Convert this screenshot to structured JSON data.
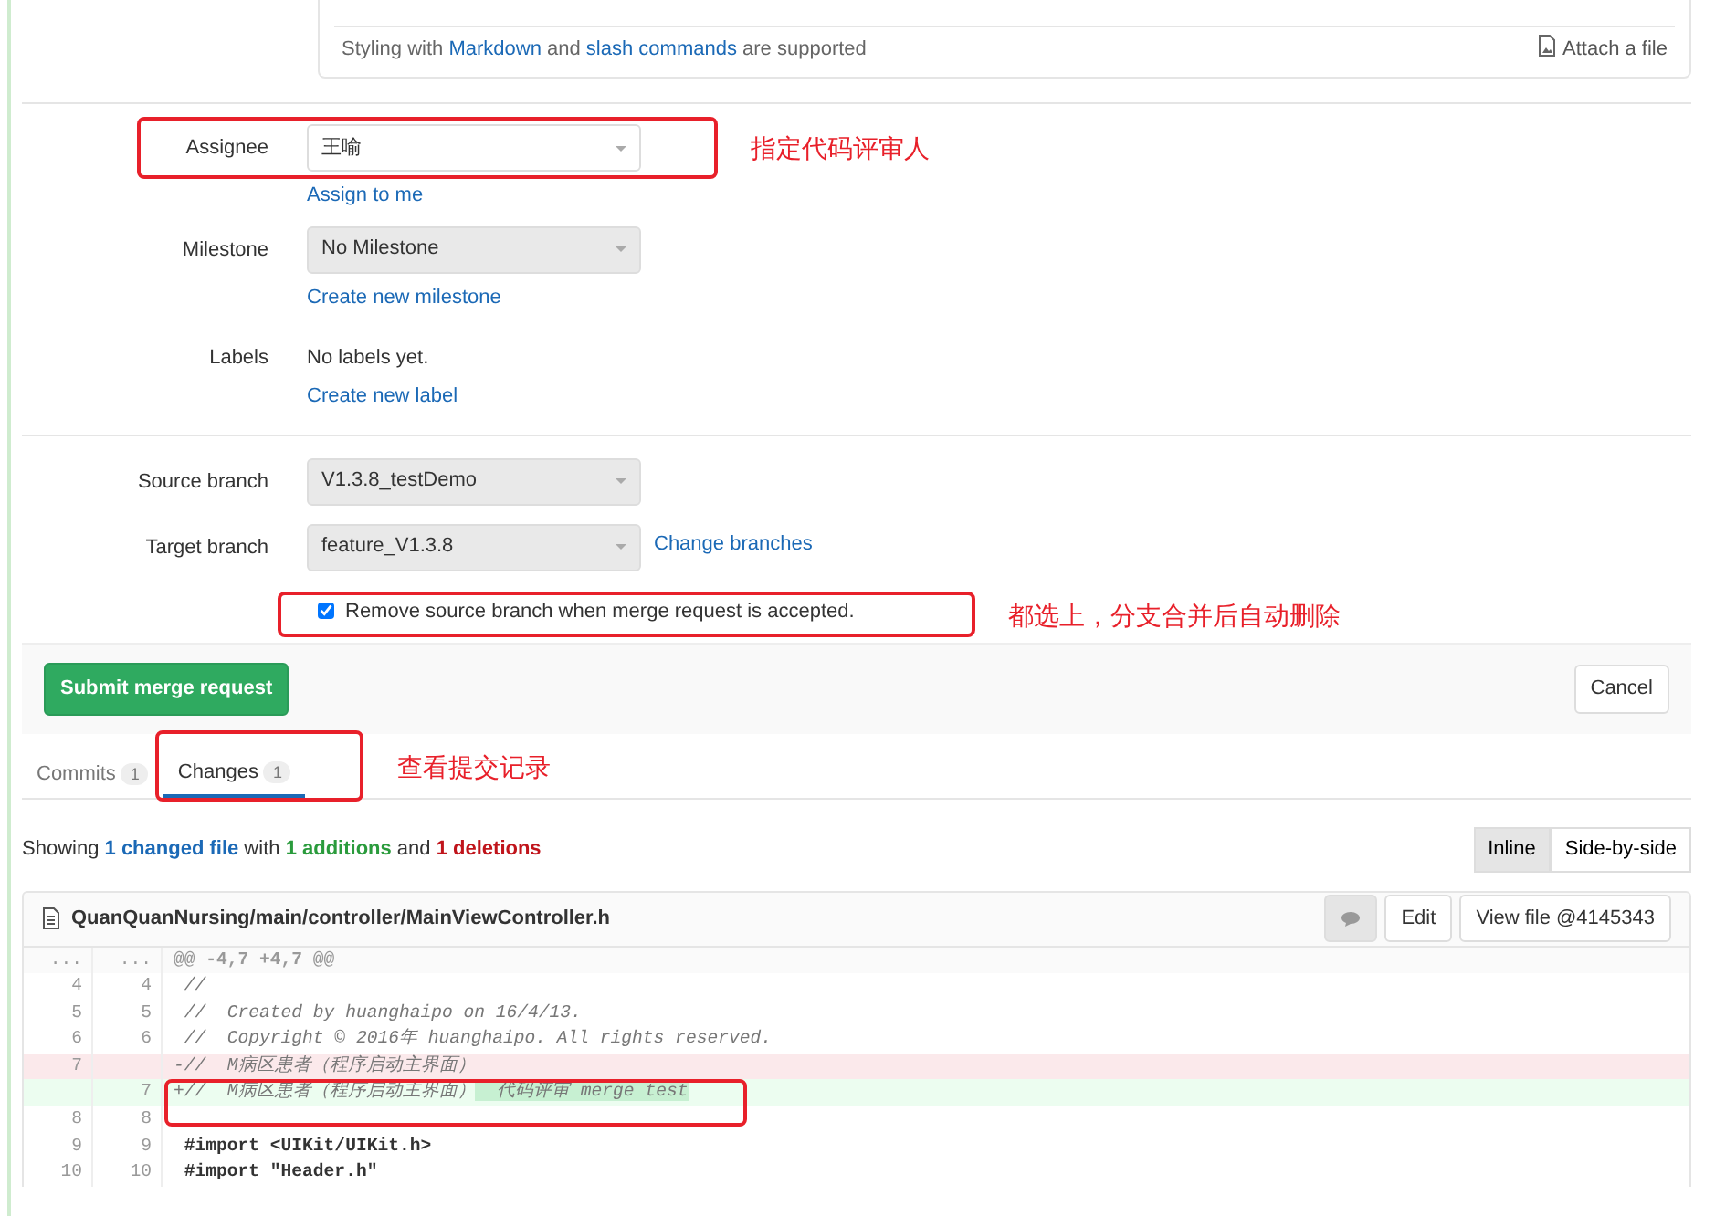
{
  "editor_footer": {
    "before": "Styling with",
    "link1": "Markdown",
    "middle": "and",
    "link2": "slash commands",
    "after": "are supported",
    "attach": "Attach a file"
  },
  "fields": [
    {
      "label": "Assignee",
      "kind": "select",
      "value": "王喻",
      "disabled": false,
      "links": [
        "Assign to me"
      ]
    },
    {
      "label": "Milestone",
      "kind": "select",
      "value": "No Milestone",
      "disabled": true,
      "links": [
        "Create new milestone"
      ]
    },
    {
      "label": "Labels",
      "kind": "text",
      "value": "No labels yet.",
      "links": [
        "Create new label"
      ]
    }
  ],
  "branches": [
    {
      "label": "Source branch",
      "value": "V1.3.8_testDemo",
      "disabled": true
    },
    {
      "label": "Target branch",
      "value": "feature_V1.3.8",
      "disabled": true,
      "side_link": "Change branches"
    }
  ],
  "remove_branch": {
    "label": "Remove source branch when merge request is accepted.",
    "checked": true
  },
  "submit_button": "Submit merge request",
  "cancel_button": "Cancel",
  "tabs": [
    {
      "label": "Commits",
      "count": "1",
      "selected": false
    },
    {
      "label": "Changes",
      "count": "1",
      "selected": true
    }
  ],
  "summary": {
    "before": "Showing",
    "files": "1 changed file",
    "with": "with",
    "additions": "1 additions",
    "and": "and",
    "deletions": "1 deletions"
  },
  "view_toggle": [
    {
      "label": "Inline",
      "selected": true
    },
    {
      "label": "Side-by-side",
      "selected": false
    }
  ],
  "file": {
    "path": "QuanQuanNursing/main/controller/MainViewController.h",
    "buttons": [
      "Edit",
      "View file @4145343"
    ]
  },
  "diff": [
    {
      "kind": "hunk",
      "old": "...",
      "new": "...",
      "code": "@@ -4,7 +4,7 @@"
    },
    {
      "kind": "context",
      "old": "4",
      "new": "4",
      "code": " //",
      "comment": true
    },
    {
      "kind": "context",
      "old": "5",
      "new": "5",
      "code": " //  Created by huanghaipo on 16/4/13.",
      "comment": true
    },
    {
      "kind": "context",
      "old": "6",
      "new": "6",
      "code": " //  Copyright © 2016年 huanghaipo. All rights reserved.",
      "comment": true
    },
    {
      "kind": "removed",
      "old": "7",
      "code": "-//  M病区患者（程序启动主界面）",
      "comment": true
    },
    {
      "kind": "added",
      "new": "7",
      "code": "+//  M病区患者（程序启动主界面）",
      "highlight": "  代码评审 merge test",
      "comment": true
    },
    {
      "kind": "context",
      "old": "8",
      "new": "8"
    },
    {
      "kind": "context",
      "old": "9",
      "new": "9",
      "code": " #import <UIKit/UIKit.h>",
      "comment": false
    },
    {
      "kind": "context",
      "old": "10",
      "new": "10",
      "code": " #import \"Header.h\"",
      "comment": false
    }
  ],
  "annotations": [
    "指定代码评审人",
    "都选上，分支合并后自动删除",
    "查看提交记录"
  ]
}
